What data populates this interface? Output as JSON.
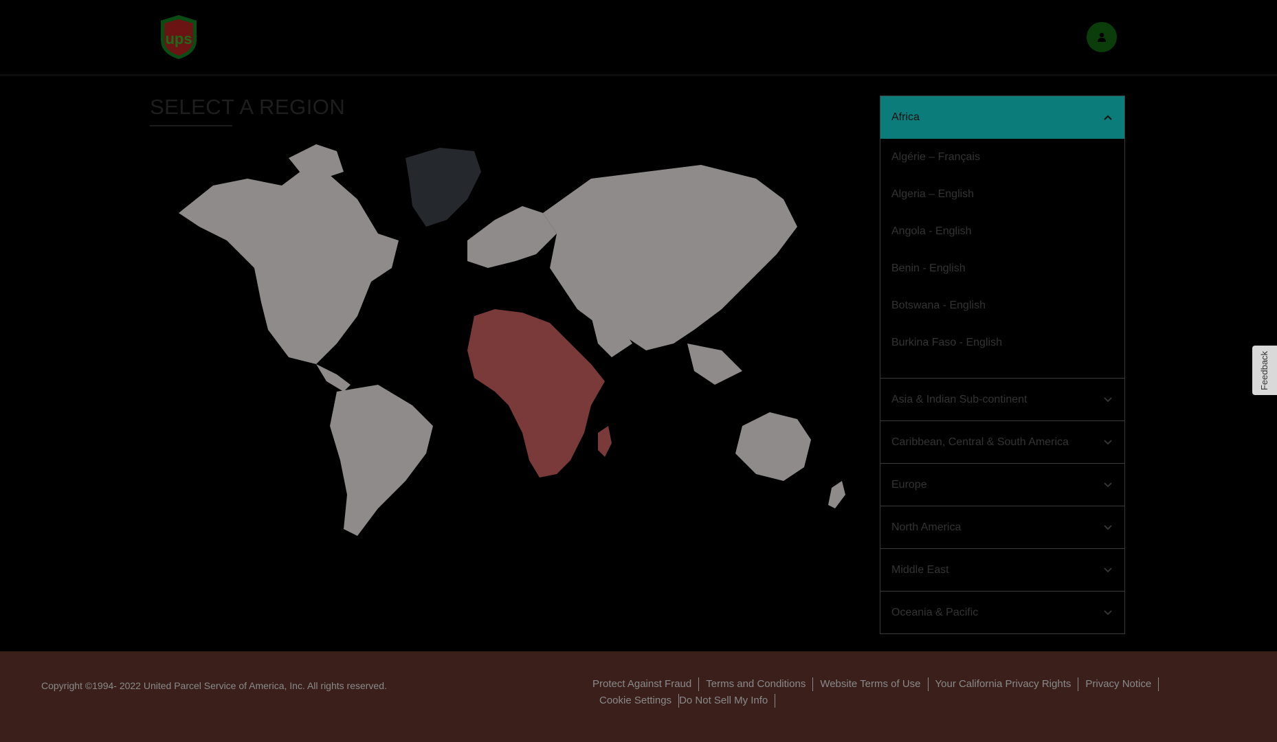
{
  "header": {
    "logo_text": "ups",
    "avatar_icon": "user-icon"
  },
  "page": {
    "title": "SELECT A REGION"
  },
  "colors": {
    "accent": "#0b7c7a",
    "africa_highlight": "#7a3a3a",
    "land": "#8f8b8b",
    "greenland": "#25282c",
    "footer_bg": "#3a1f1b"
  },
  "regions": {
    "open": {
      "label": "Africa",
      "countries": [
        "Algérie – Français",
        "Algeria – English",
        "Angola - English",
        "Benin - English",
        "Botswana - English",
        "Burkina Faso - English"
      ]
    },
    "collapsed": [
      "Asia & Indian Sub-continent",
      "Caribbean, Central & South America",
      "Europe",
      "North America",
      "Middle East",
      "Oceania & Pacific"
    ]
  },
  "feedback": {
    "label": "Feedback"
  },
  "footer": {
    "copyright": "Copyright ©1994- 2022  United Parcel Service of America, Inc. All rights reserved.",
    "links": [
      "Protect Against Fraud",
      "Terms and Conditions",
      "Website Terms of Use",
      "Your California Privacy Rights",
      "Privacy Notice",
      "Cookie Settings",
      "Do Not Sell My Info"
    ]
  }
}
